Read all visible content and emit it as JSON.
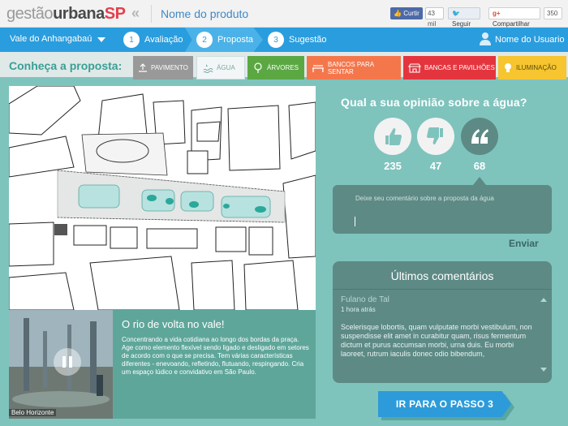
{
  "header": {
    "logo_part1": "gestão",
    "logo_part2": "urbana",
    "logo_part3": "SP",
    "product_name": "Nome do produto",
    "like_label": "Curtir",
    "like_count": "43 mil",
    "follow_label": "Seguir",
    "share_label": "Compartilhar",
    "share_count": "350"
  },
  "steps": {
    "location": "Vale do Anhangabaú",
    "items": [
      {
        "num": "1",
        "label": "Avaliação"
      },
      {
        "num": "2",
        "label": "Proposta"
      },
      {
        "num": "3",
        "label": "Sugestão"
      }
    ],
    "user_name": "Nome do Usuario"
  },
  "categories": {
    "label": "Conheça a proposta:",
    "tabs": [
      "PAVIMENTO",
      "ÁGUA",
      "ÁRVORES",
      "BANCOS PARA SENTAR",
      "BANCAS E PAVILHÕES",
      "ILUMINAÇÃO"
    ]
  },
  "info": {
    "title": "O rio de volta no vale!",
    "text": "Concentrando a vida cotidiana ao longo dos bordas da praça. Age como elemento flexível sendo ligado e desligado em setores de acordo com o que se precisa. Tem várias características diferentes - enevoando, refletindo, flutuando, respingando. Cria um espaço lúdico e convidativo em São Paulo.",
    "photo_caption": "Belo Horizonte"
  },
  "opinion": {
    "question": "Qual a sua opinião sobre a água?",
    "like_count": "235",
    "dislike_count": "47",
    "comment_count": "68",
    "placeholder": "Deixe seu comentário sobre a proposta da água",
    "send_label": "Enviar"
  },
  "comments": {
    "title": "Últimos comentários",
    "author": "Fulano de Tal",
    "time": "1 hora atrás",
    "text": "Scelerisque lobortis, quam vulputate morbi vestibulum, non suspendisse elit amet in curabitur quam, risus fermentum dictum et purus accumsan morbi, urna duis. Eu morbi laoreet, rutrum iaculis donec odio bibendum,"
  },
  "next_button": "IR PARA O PASSO 3",
  "colors": {
    "background": "#7fc3bd",
    "step_blue": "#2a9dde",
    "dark_teal": "#5d8a85",
    "brand_red": "#e2404c"
  }
}
